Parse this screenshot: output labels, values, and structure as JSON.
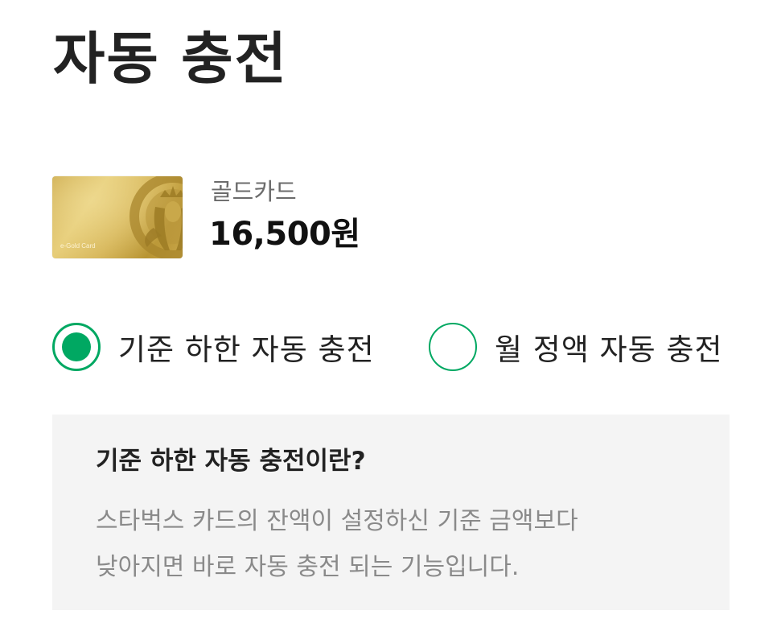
{
  "header": {
    "title": "자동 충전"
  },
  "card": {
    "image_label": "e-Gold Card",
    "name": "골드카드",
    "balance": "16,500원"
  },
  "options": [
    {
      "label": "기준 하한 자동 충전",
      "selected": true
    },
    {
      "label": "월 정액 자동 충전",
      "selected": false
    }
  ],
  "info": {
    "title": "기준 하한 자동 충전이란?",
    "lines": [
      "스타벅스 카드의 잔액이 설정하신 기준 금액보다",
      "낮아지면 바로 자동 충전 되는 기능입니다."
    ]
  },
  "colors": {
    "accent": "#00a862",
    "info_background": "#f4f4f4",
    "card_gold": "#d4b14f"
  }
}
